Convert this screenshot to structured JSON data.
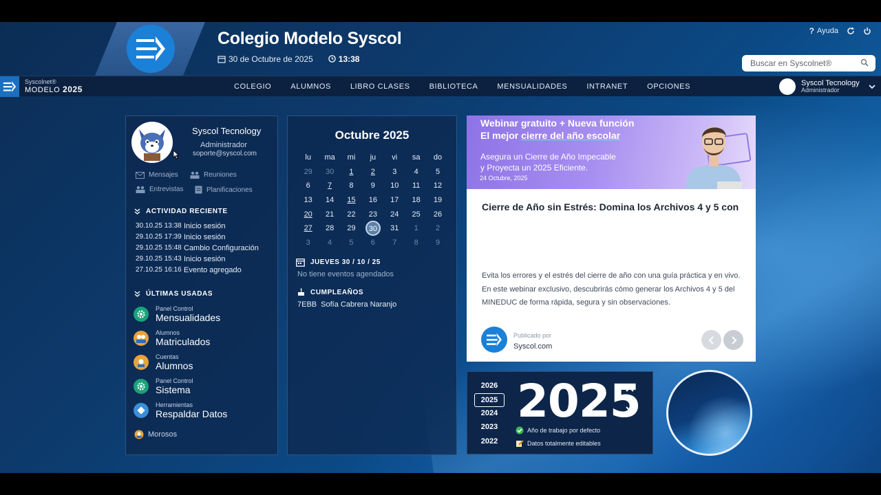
{
  "header": {
    "school_name": "Colegio Modelo Syscol",
    "date": "30 de Octubre de 2025",
    "time": "13:38",
    "help_label": "Ayuda",
    "search_placeholder": "Buscar en Syscolnet®"
  },
  "navbar": {
    "brand_small": "Syscolnet®",
    "brand_big": "MODELO",
    "brand_year": "2025",
    "menu": [
      "COLEGIO",
      "ALUMNOS",
      "LIBRO CLASES",
      "BIBLIOTECA",
      "MENSUALIDADES",
      "INTRANET",
      "OPCIONES"
    ],
    "user_name": "Syscol Tecnology",
    "user_role": "Administrador"
  },
  "profile": {
    "name": "Syscol Tecnology",
    "role": "Administrador",
    "email": "soporte@syscol.com",
    "quick_links": [
      "Mensajes",
      "Reuniones",
      "Entrevistas",
      "Planificaciones"
    ],
    "activity_title": "ACTIVIDAD RECIENTE",
    "activity": [
      {
        "date": "30.10.25 13:38",
        "event": "Inicio sesión"
      },
      {
        "date": "29.10.25 17:39",
        "event": "Inicio sesión"
      },
      {
        "date": "29.10.25 15:48",
        "event": "Cambio Configuración"
      },
      {
        "date": "29.10.25 15:43",
        "event": "Inicio sesión"
      },
      {
        "date": "27.10.25 16:16",
        "event": "Evento agregado"
      }
    ],
    "used_title": "ÚLTIMAS USADAS",
    "used": [
      {
        "category": "Panel Control",
        "title": "Mensualidades",
        "color": "#1aa37a"
      },
      {
        "category": "Alumnos",
        "title": "Matriculados",
        "color": "#e8a33a"
      },
      {
        "category": "Cuentas",
        "title": "Alumnos",
        "color": "#e8a33a"
      },
      {
        "category": "Panel Control",
        "title": "Sistema",
        "color": "#1aa37a"
      },
      {
        "category": "Herramientas",
        "title": "Respaldar Datos",
        "color": "#3a8fd9"
      }
    ],
    "extra_link": "Morosos"
  },
  "calendar": {
    "month_title": "Octubre 2025",
    "weekdays": [
      "lu",
      "ma",
      "mi",
      "ju",
      "vi",
      "sa",
      "do"
    ],
    "weeks": [
      [
        "29",
        "30",
        "1",
        "2",
        "3",
        "4",
        "5"
      ],
      [
        "6",
        "7",
        "8",
        "9",
        "10",
        "11",
        "12"
      ],
      [
        "13",
        "14",
        "15",
        "16",
        "17",
        "18",
        "19"
      ],
      [
        "20",
        "21",
        "22",
        "23",
        "24",
        "25",
        "26"
      ],
      [
        "27",
        "28",
        "29",
        "30",
        "31",
        "1",
        "2"
      ],
      [
        "3",
        "4",
        "5",
        "6",
        "7",
        "8",
        "9"
      ]
    ],
    "selected_day_title": "JUEVES 30 / 10 / 25",
    "no_events": "No tiene eventos agendados",
    "birthdays_title": "CUMPLEAÑOS",
    "birthdays": [
      {
        "group": "7EBB",
        "name": "Sofía Cabrera Naranjo"
      }
    ]
  },
  "news": {
    "banner_line1": "Webinar gratuito + Nueva función",
    "banner_line2_pre": "El mejor ",
    "banner_line2_em": "cierre del año escolar",
    "banner_line3": "Asegura un Cierre de Año Impecable",
    "banner_line4": "y Proyecta un 2025 Eficiente.",
    "banner_date": "24 Octubre, 2025",
    "title": "Cierre de Año sin Estrés: Domina los Archivos 4 y 5 con",
    "body": "Evita los errores y el estrés del cierre de año con una guía práctica y en vivo. En este webinar exclusivo, descubrirás cómo generar los Archivos 4 y 5 del MINEDUC de forma rápida, segura y sin observaciones.",
    "published_by_label": "Publicado por",
    "publisher": "Syscol.com"
  },
  "years": {
    "list": [
      "2026",
      "2025",
      "2024",
      "2023",
      "2022"
    ],
    "selected": "2025",
    "big": "2025",
    "note1": "Año de trabajo por defecto",
    "note2": "Datos totalmente editables"
  },
  "colors": {
    "accent": "#1b80d8",
    "nav": "#0c2140",
    "panel": "#0d284e"
  }
}
